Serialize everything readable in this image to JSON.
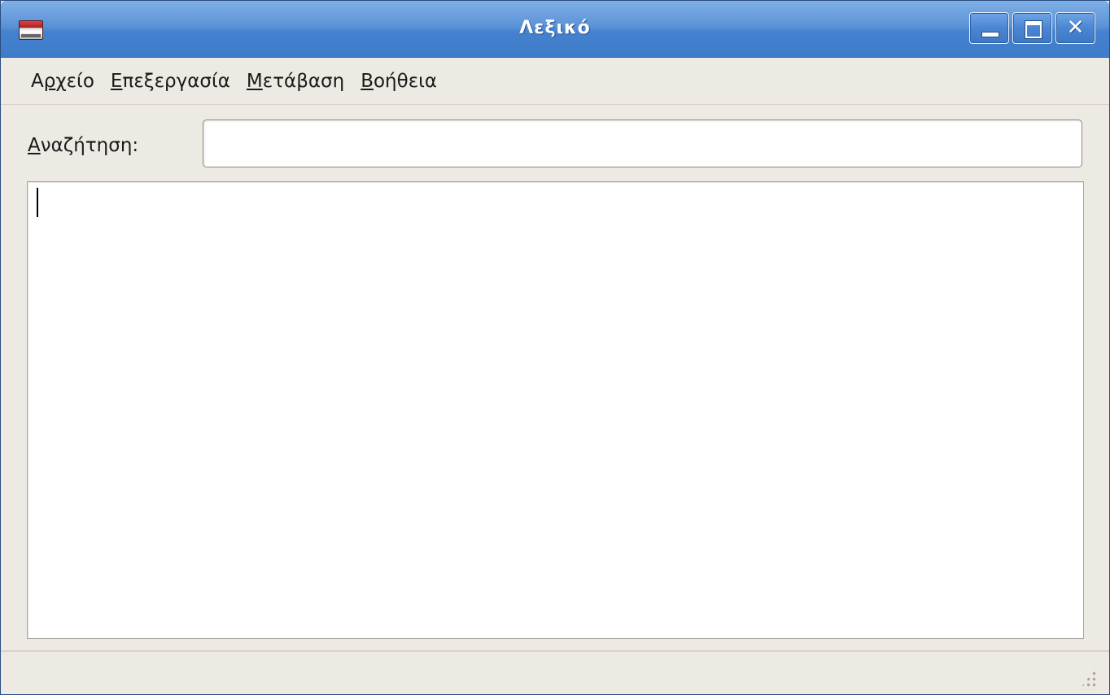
{
  "window": {
    "title": "Λεξικό",
    "icon": "dictionary-app-icon",
    "controls": {
      "minimize_icon": "minimize-icon",
      "maximize_icon": "maximize-icon",
      "close_icon": "close-icon",
      "close_glyph": "✕"
    }
  },
  "menubar": {
    "items": [
      {
        "pre": "Α",
        "mnemonic": "ρ",
        "post": "χείο"
      },
      {
        "pre": "",
        "mnemonic": "Ε",
        "post": "πεξεργασία"
      },
      {
        "pre": "",
        "mnemonic": "Μ",
        "post": "ετάβαση"
      },
      {
        "pre": "",
        "mnemonic": "Β",
        "post": "οήθεια"
      }
    ]
  },
  "search": {
    "label_mnemonic": "Α",
    "label_rest": "ναζήτηση:",
    "value": "",
    "placeholder": ""
  },
  "result": {
    "text": ""
  },
  "colors": {
    "titlebar": "#4a86d4",
    "window_bg": "#edeae4"
  }
}
